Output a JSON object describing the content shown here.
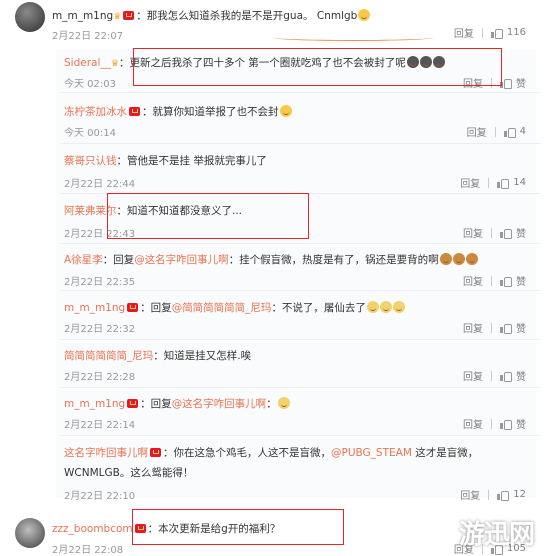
{
  "main_comment": {
    "user": "m_m_m1ng",
    "text": "：那我怎么知道杀我的是不是开gua。 Cnmlgb",
    "time": "2月22日 22:07",
    "reply_label": "回复",
    "likes": "116"
  },
  "replies": [
    {
      "user": "Sideral__",
      "text": "：更新之后我杀了四十多个 第一个圈就吃鸡了也不会被封了呢",
      "time": "今天 02:03",
      "reply_label": "回复",
      "likes": "赞"
    },
    {
      "user": "冻柠茶加冰水",
      "text": "：就算你知道举报了也不会封",
      "time": "今天 00:14",
      "reply_label": "回复",
      "likes": "4"
    },
    {
      "user": "蔡哥只认钱",
      "text": "：管他是不是挂 举报就完事儿了",
      "time": "2月22日 22:44",
      "reply_label": "回复",
      "likes": "14"
    },
    {
      "user": "阿莱弗莱尔",
      "text": "：知道不知道都没意义了...",
      "time": "2月22日 22:43",
      "reply_label": "回复",
      "likes": "赞"
    },
    {
      "user": "A徐星李",
      "prefix": "：回复",
      "mention": "@这名字咋回事儿啊",
      "text": "：挂个假盲微，热度是有了，锅还是要背的啊",
      "time": "2月22日 22:35",
      "reply_label": "回复",
      "likes": "赞"
    },
    {
      "user": "m_m_m1ng",
      "prefix": "：回复",
      "mention": "@简简简简简简_尼玛",
      "text": "：不说了，屠仙去了",
      "time": "2月22日 22:32",
      "reply_label": "回复",
      "likes": "赞"
    },
    {
      "user": "简简简简简简_尼玛",
      "text": "：知道是挂又怎样.唉",
      "time": "2月22日 22:28",
      "reply_label": "回复",
      "likes": "赞"
    },
    {
      "user": "m_m_m1ng",
      "prefix": "：回复",
      "mention": "@这名字咋回事儿啊",
      "text": "：",
      "time": "2月22日 22:14",
      "reply_label": "回复",
      "likes": "赞"
    },
    {
      "user": "这名字咋回事儿啊",
      "text": "：你在这急个鸡毛，人这不是盲微，",
      "mention2": "@PUBG_STEAM",
      "text2": " 这才是盲微，",
      "text3": "WCNMLGB。这么鸳能得！",
      "time": "2月22日 22:10",
      "reply_label": "回复",
      "likes": "12"
    }
  ],
  "last_comment": {
    "user": "zzz_boombcom",
    "text": "：本次更新是给g开的福利？",
    "time": "2月22日 22:08",
    "reply_label": "回复",
    "likes": "105"
  },
  "watermark": "游迅网"
}
